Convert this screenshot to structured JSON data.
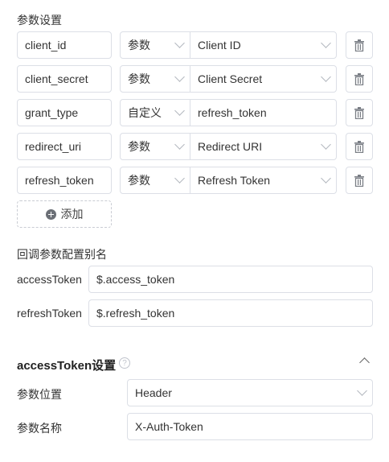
{
  "params": {
    "title": "参数设置",
    "rows": [
      {
        "name": "client_id",
        "type": "参数",
        "value": "Client ID"
      },
      {
        "name": "client_secret",
        "type": "参数",
        "value": "Client Secret"
      },
      {
        "name": "grant_type",
        "type": "自定义",
        "value": "refresh_token"
      },
      {
        "name": "redirect_uri",
        "type": "参数",
        "value": "Redirect URI"
      },
      {
        "name": "refresh_token",
        "type": "参数",
        "value": "Refresh Token"
      }
    ],
    "add_label": "添加"
  },
  "callback": {
    "title": "回调参数配置别名",
    "access_label": "accessToken",
    "access_value": "$.access_token",
    "refresh_label": "refreshToken",
    "refresh_value": "$.refresh_token"
  },
  "token_settings": {
    "title": "accessToken设置",
    "position_label": "参数位置",
    "position_value": "Header",
    "name_label": "参数名称",
    "name_value": "X-Auth-Token"
  },
  "icons": {
    "delete": "trash-icon",
    "add": "plus-circle-icon",
    "help": "help-circle-icon",
    "collapse": "chevron-up-icon",
    "dropdown": "chevron-down-icon"
  }
}
